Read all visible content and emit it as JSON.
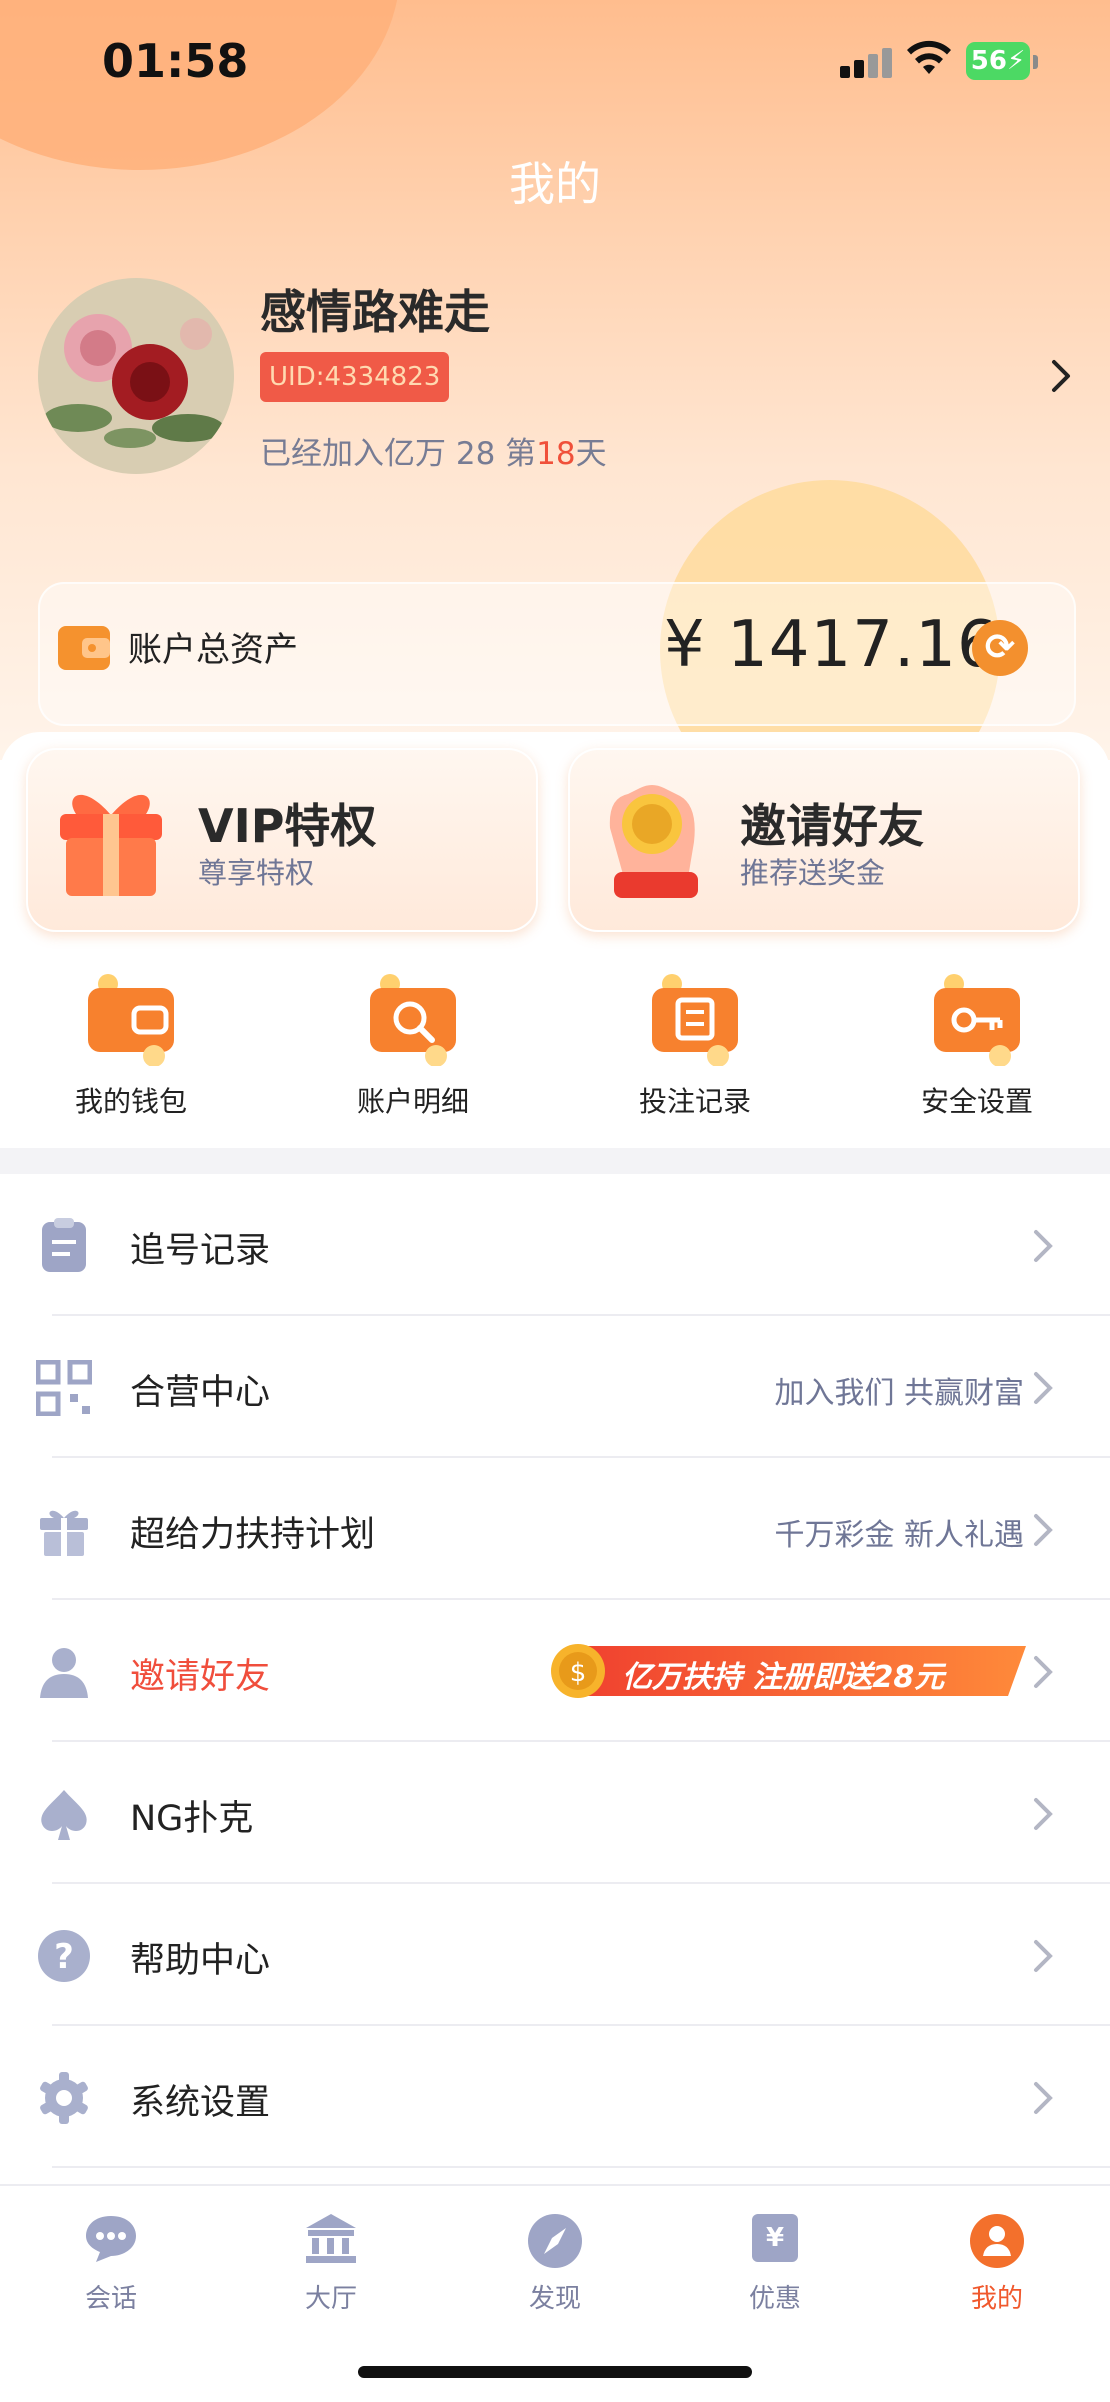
{
  "status_bar": {
    "time": "01:58",
    "battery": "56"
  },
  "header": {
    "title": "我的"
  },
  "profile": {
    "username": "感情路难走",
    "uid": "UID:4334823",
    "joined_prefix": "已经加入亿万 28 第",
    "joined_days": "18",
    "joined_suffix": "天"
  },
  "assets": {
    "label": "账户总资产",
    "amount": "¥ 1417.16"
  },
  "feature_cards": [
    {
      "title": "VIP特权",
      "subtitle": "尊享特权",
      "icon": "gift-box-icon"
    },
    {
      "title": "邀请好友",
      "subtitle": "推荐送奖金",
      "icon": "hand-coin-icon"
    }
  ],
  "quick_actions": [
    {
      "label": "我的钱包",
      "icon": "wallet-icon"
    },
    {
      "label": "账户明细",
      "icon": "magnifier-icon"
    },
    {
      "label": "投注记录",
      "icon": "record-icon"
    },
    {
      "label": "安全设置",
      "icon": "key-icon"
    }
  ],
  "menu": [
    {
      "label": "追号记录",
      "right": "",
      "icon": "clipboard-icon"
    },
    {
      "label": "合营中心",
      "right": "加入我们 共赢财富",
      "icon": "qr-code-icon"
    },
    {
      "label": "超给力扶持计划",
      "right": "千万彩金 新人礼遇",
      "icon": "gift-icon"
    },
    {
      "label": "邀请好友",
      "right": "",
      "icon": "users-icon",
      "promo": "亿万扶持 注册即送28元"
    },
    {
      "label": "NG扑克",
      "right": "",
      "icon": "spade-icon"
    },
    {
      "label": "帮助中心",
      "right": "",
      "icon": "question-icon"
    },
    {
      "label": "系统设置",
      "right": "",
      "icon": "gear-icon"
    }
  ],
  "tabs": [
    {
      "label": "会话",
      "icon": "chat-icon"
    },
    {
      "label": "大厅",
      "icon": "hall-icon"
    },
    {
      "label": "发现",
      "icon": "compass-icon"
    },
    {
      "label": "优惠",
      "icon": "coupon-icon"
    },
    {
      "label": "我的",
      "icon": "user-icon",
      "active": true
    }
  ],
  "colors": {
    "accent": "#f0582c",
    "badge": "#f05a47",
    "muted": "#6f7696"
  }
}
